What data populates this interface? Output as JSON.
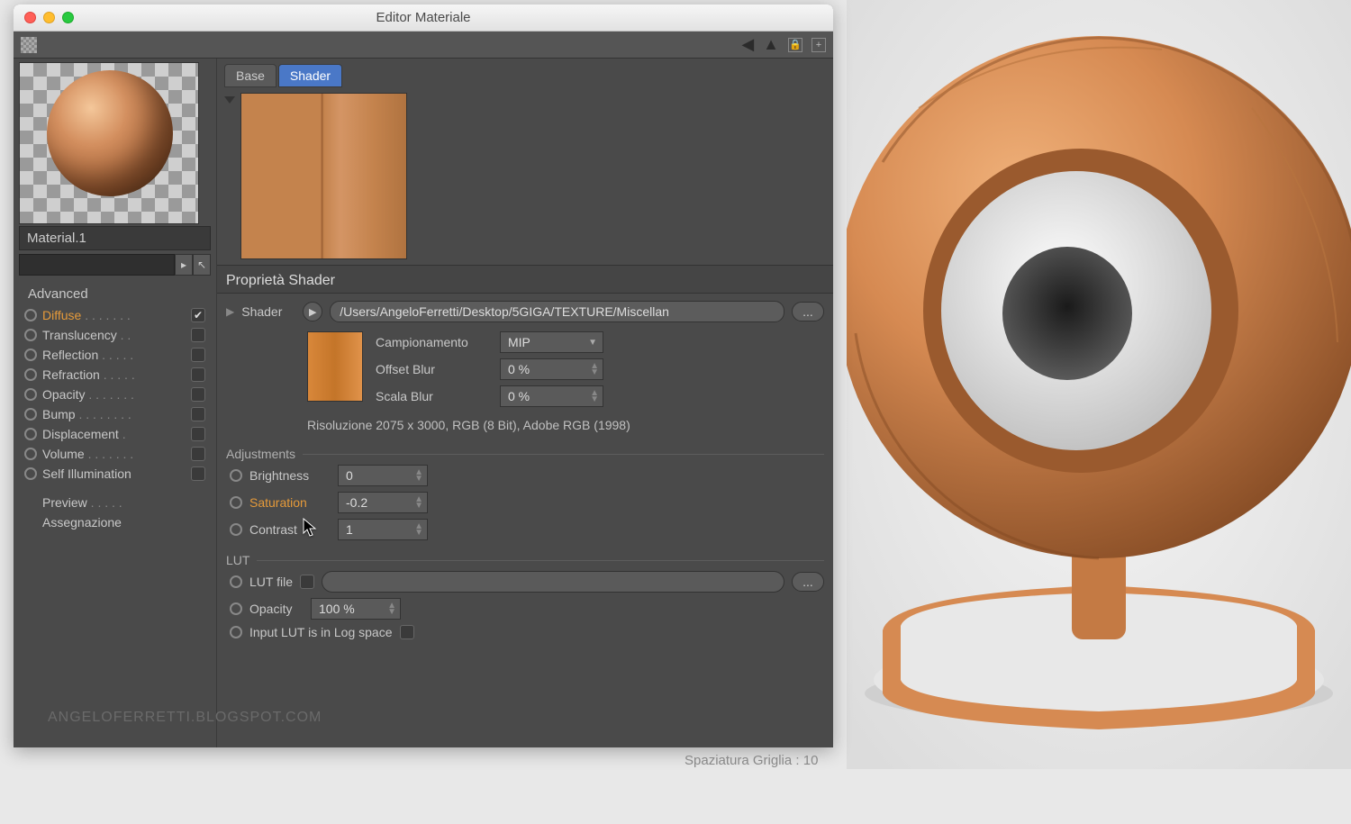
{
  "window": {
    "title": "Editor Materiale"
  },
  "material": {
    "name": "Material.1"
  },
  "sidebar": {
    "advanced": "Advanced",
    "channels": [
      {
        "label": "Diffuse",
        "checked": true,
        "active": true
      },
      {
        "label": "Translucency",
        "checked": false
      },
      {
        "label": "Reflection",
        "checked": false
      },
      {
        "label": "Refraction",
        "checked": false
      },
      {
        "label": "Opacity",
        "checked": false
      },
      {
        "label": "Bump",
        "checked": false
      },
      {
        "label": "Displacement",
        "checked": false
      },
      {
        "label": "Volume",
        "checked": false
      },
      {
        "label": "Self Illumination",
        "checked": false
      }
    ],
    "preview": "Preview",
    "assignment": "Assegnazione"
  },
  "tabs": {
    "base": "Base",
    "shader": "Shader"
  },
  "section": "Proprietà Shader",
  "shader": {
    "label": "Shader",
    "path": "/Users/AngeloFerretti/Desktop/5GIGA/TEXTURE/Miscellan",
    "sampling_label": "Campionamento",
    "sampling_value": "MIP",
    "offset_blur_label": "Offset Blur",
    "offset_blur_value": "0 %",
    "scale_blur_label": "Scala Blur",
    "scale_blur_value": "0 %",
    "resolution": "Risoluzione 2075 x 3000, RGB (8 Bit), Adobe RGB (1998)"
  },
  "adjustments": {
    "title": "Adjustments",
    "brightness_label": "Brightness",
    "brightness_value": "0",
    "saturation_label": "Saturation",
    "saturation_value": "-0.2",
    "contrast_label": "Contrast",
    "contrast_value": "1"
  },
  "lut": {
    "title": "LUT",
    "file_label": "LUT file",
    "opacity_label": "Opacity",
    "opacity_value": "100 %",
    "logspace_label": "Input LUT is in Log space"
  },
  "watermark": "ANGELOFERRETTI.BLOGSPOT.COM",
  "viewport_hint": "Spaziatura Griglia : 10"
}
